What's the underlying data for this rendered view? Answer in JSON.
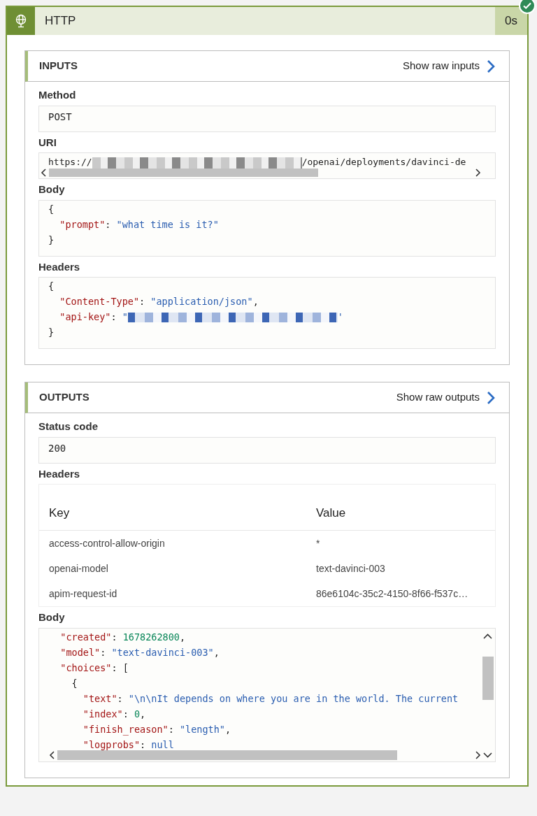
{
  "action": {
    "title": "HTTP",
    "duration": "0s",
    "succeeded": true
  },
  "inputs": {
    "heading": "INPUTS",
    "raw_link": "Show raw inputs",
    "fields": [
      {
        "kind": "text",
        "label": "Method",
        "value": "POST"
      },
      {
        "kind": "uri",
        "label": "URI",
        "parts": [
          {
            "kind": "text",
            "s": "https://"
          },
          {
            "kind": "redacted"
          },
          {
            "kind": "text",
            "s": "/openai/deployments/davinci-de"
          }
        ]
      },
      {
        "kind": "code",
        "label": "Body",
        "lines": [
          [
            {
              "kind": "punct",
              "s": "{"
            }
          ],
          [
            {
              "kind": "key",
              "s": "  \"prompt\""
            },
            {
              "kind": "punct",
              "s": ": "
            },
            {
              "kind": "string",
              "s": "\"what time is it?\""
            }
          ],
          [
            {
              "kind": "punct",
              "s": "}"
            }
          ]
        ]
      },
      {
        "kind": "code",
        "label": "Headers",
        "lines": [
          [
            {
              "kind": "punct",
              "s": "{"
            }
          ],
          [
            {
              "kind": "key",
              "s": "  \"Content-Type\""
            },
            {
              "kind": "punct",
              "s": ": "
            },
            {
              "kind": "string",
              "s": "\"application/json\""
            },
            {
              "kind": "punct",
              "s": ","
            }
          ],
          [
            {
              "kind": "key",
              "s": "  \"api-key\""
            },
            {
              "kind": "punct",
              "s": ": "
            },
            {
              "kind": "string",
              "s": "\""
            },
            {
              "kind": "redacted"
            },
            {
              "kind": "string",
              "s": "'"
            }
          ],
          [
            {
              "kind": "punct",
              "s": "}"
            }
          ]
        ]
      }
    ]
  },
  "outputs": {
    "heading": "OUTPUTS",
    "raw_link": "Show raw outputs",
    "fields": [
      {
        "kind": "text",
        "label": "Status code",
        "value": "200"
      },
      {
        "kind": "table",
        "label": "Headers",
        "columns": [
          "Key",
          "Value"
        ],
        "rows": [
          [
            "access-control-allow-origin",
            "*"
          ],
          [
            "openai-model",
            "text-davinci-003"
          ],
          [
            "apim-request-id",
            "86e6104c-35c2-4150-8f66-f537c…"
          ]
        ]
      },
      {
        "kind": "code",
        "label": "Body",
        "lines": [
          [
            {
              "kind": "key",
              "s": "  \"created\""
            },
            {
              "kind": "punct",
              "s": ": "
            },
            {
              "kind": "number",
              "s": "1678262800"
            },
            {
              "kind": "punct",
              "s": ","
            }
          ],
          [
            {
              "kind": "key",
              "s": "  \"model\""
            },
            {
              "kind": "punct",
              "s": ": "
            },
            {
              "kind": "string",
              "s": "\"text-davinci-003\""
            },
            {
              "kind": "punct",
              "s": ","
            }
          ],
          [
            {
              "kind": "key",
              "s": "  \"choices\""
            },
            {
              "kind": "punct",
              "s": ": ["
            }
          ],
          [
            {
              "kind": "punct",
              "s": "    {"
            }
          ],
          [
            {
              "kind": "key",
              "s": "      \"text\""
            },
            {
              "kind": "punct",
              "s": ": "
            },
            {
              "kind": "string",
              "s": "\"\\n\\nIt depends on where you are in the world. The current"
            }
          ],
          [
            {
              "kind": "key",
              "s": "      \"index\""
            },
            {
              "kind": "punct",
              "s": ": "
            },
            {
              "kind": "number",
              "s": "0"
            },
            {
              "kind": "punct",
              "s": ","
            }
          ],
          [
            {
              "kind": "key",
              "s": "      \"finish_reason\""
            },
            {
              "kind": "punct",
              "s": ": "
            },
            {
              "kind": "string",
              "s": "\"length\""
            },
            {
              "kind": "punct",
              "s": ","
            }
          ],
          [
            {
              "kind": "key",
              "s": "      \"logprobs\""
            },
            {
              "kind": "punct",
              "s": ": "
            },
            {
              "kind": "literal",
              "s": "null"
            }
          ]
        ]
      }
    ]
  }
}
